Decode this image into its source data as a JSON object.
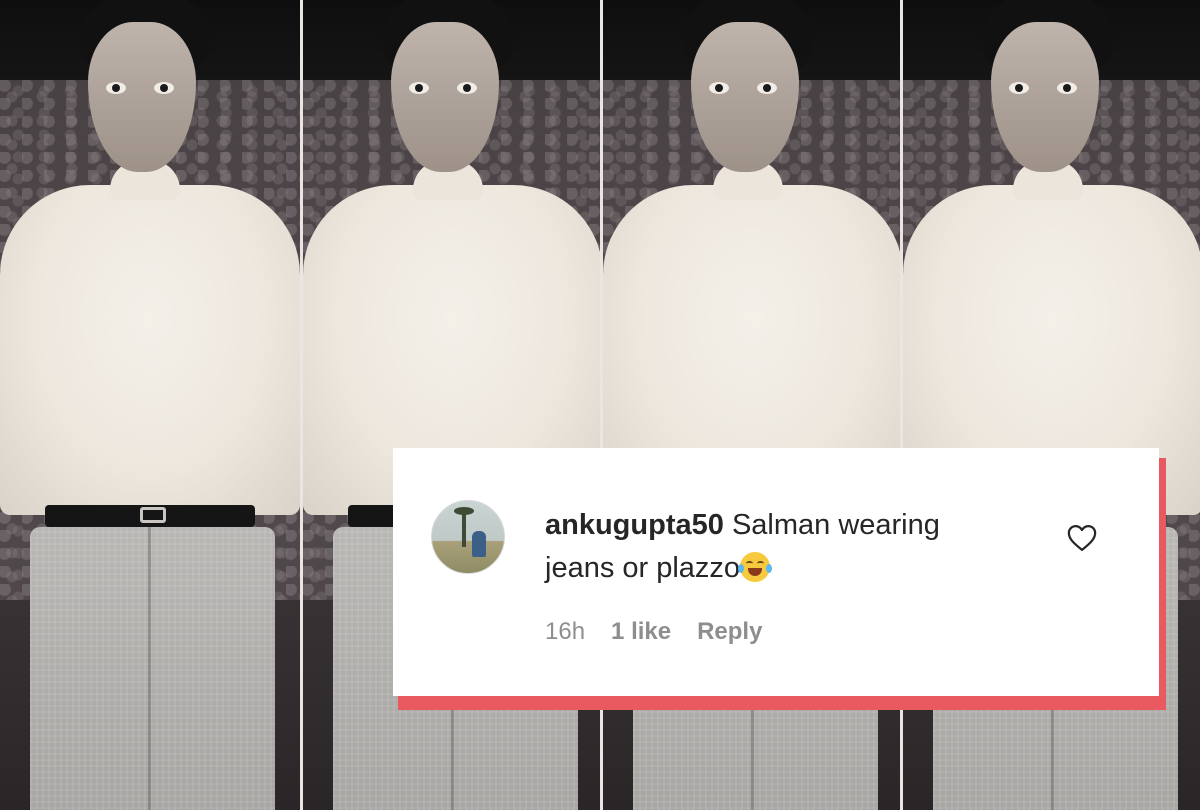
{
  "comment": {
    "username": "ankugupta50",
    "text": "Salman wearing jeans or plazzo",
    "emoji": "face-with-tears-of-joy",
    "time": "16h",
    "likes": "1 like",
    "reply_label": "Reply",
    "like_icon": "heart-outline-icon"
  },
  "colors": {
    "accent_strip": "#e85a5f",
    "card_background": "#ffffff",
    "text": "#262626",
    "meta_text": "#8e8e8e"
  }
}
